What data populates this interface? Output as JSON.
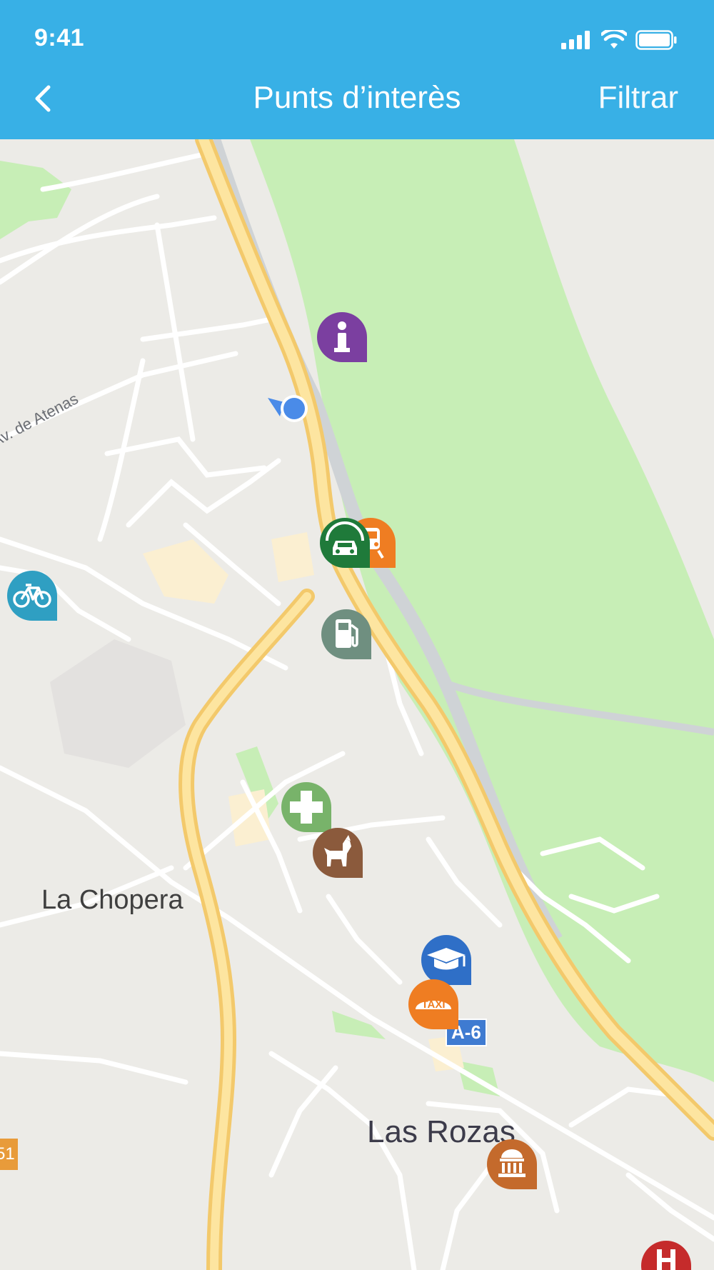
{
  "status_bar": {
    "time": "9:41"
  },
  "nav": {
    "title": "Punts d’interès",
    "filter_label": "Filtrar"
  },
  "map": {
    "labels": {
      "street_atenas": "Av. de Atenas",
      "place_chopera": "La Chopera",
      "place_rozas": "Las Rozas",
      "road_a6": "A-6",
      "road_partial": "51"
    },
    "pois": [
      {
        "name": "info",
        "color": "#7b3fa0"
      },
      {
        "name": "ev-charging",
        "color": "#1f7a3a"
      },
      {
        "name": "train",
        "color": "#ef7d22"
      },
      {
        "name": "bike",
        "color": "#2f9fc2"
      },
      {
        "name": "fuel",
        "color": "#6f8f80"
      },
      {
        "name": "pharmacy",
        "color": "#78b36a"
      },
      {
        "name": "pets",
        "color": "#8b5a3c"
      },
      {
        "name": "education",
        "color": "#2f6fc7"
      },
      {
        "name": "taxi",
        "color": "#ef7d22"
      },
      {
        "name": "museum",
        "color": "#c46a2c"
      },
      {
        "name": "hospital",
        "color": "#c52b2b"
      }
    ],
    "poi_taxi_text": "TAXI"
  }
}
